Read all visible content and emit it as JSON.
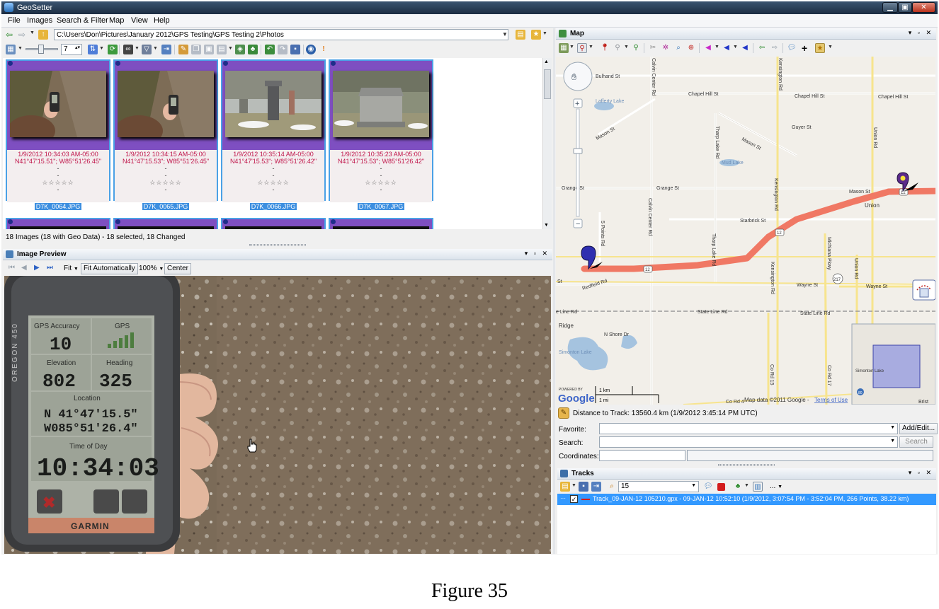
{
  "window": {
    "title": "GeoSetter"
  },
  "menu": [
    "File",
    "Images",
    "Search & Filter",
    "Map",
    "View",
    "Help"
  ],
  "path": {
    "value": "C:\\Users\\Don\\Pictures\\January 2012\\GPS Testing\\GPS Testing 2\\Photos"
  },
  "thumb_toolbar": {
    "size_value": "7"
  },
  "thumbnails": [
    {
      "date": "1/9/2012 10:34:03 AM-05:00",
      "coords": "N41°47'15.51\"; W85°51'26.45\"",
      "dash1": "-",
      "dash2": "-",
      "stars": "☆☆☆☆☆",
      "dash3": "-",
      "filename": "D7K_0064.JPG"
    },
    {
      "date": "1/9/2012 10:34:15 AM-05:00",
      "coords": "N41°47'15.53\"; W85°51'26.45\"",
      "dash1": "-",
      "dash2": "-",
      "stars": "☆☆☆☆☆",
      "dash3": "-",
      "filename": "D7K_0065.JPG"
    },
    {
      "date": "1/9/2012 10:35:14 AM-05:00",
      "coords": "N41°47'15.53\"; W85°51'26.42\"",
      "dash1": "-",
      "dash2": "-",
      "stars": "☆☆☆☆☆",
      "dash3": "-",
      "filename": "D7K_0066.JPG"
    },
    {
      "date": "1/9/2012 10:35:23 AM-05:00",
      "coords": "N41°47'15.53\"; W85°51'26.42\"",
      "dash1": "-",
      "dash2": "-",
      "stars": "☆☆☆☆☆",
      "dash3": "-",
      "filename": "D7K_0067.JPG"
    }
  ],
  "status": {
    "images": "18 Images (18 with Geo Data) - 18 selected, 18 Changed"
  },
  "preview": {
    "title": "Image Preview",
    "fit_label": "Fit",
    "fit_auto_label": "Fit Automatically",
    "zoom": "100%",
    "center_label": "Center"
  },
  "gps_device": {
    "brand": "GARMIN",
    "model": "OREGON 450",
    "accuracy_label": "GPS Accuracy",
    "accuracy_value": "10",
    "gps_label": "GPS",
    "elevation_label": "Elevation",
    "elevation_value": "802",
    "heading_label": "Heading",
    "heading_value": "325",
    "location_label": "Location",
    "lat": "N  41°47'15.5\"",
    "lon": "W085°51'26.4\"",
    "time_label": "Time of Day",
    "time_value": "10:34:03"
  },
  "map": {
    "title": "Map",
    "streets": {
      "bulhand": "Bulhand St",
      "calvin1": "Calvin Center Rd",
      "kensington1": "Kensington Rd",
      "chapel1": "Chapel Hill St",
      "chapel2": "Chapel Hill St",
      "chapel3": "Chapel Hill St",
      "lafferty": "Lafferty Lake",
      "mason1": "Mason St",
      "guyer": "Guyer St",
      "union_rd": "Union Rd",
      "tharp1": "Tharp Lake Rd",
      "mason2": "Mason St",
      "mud": "Mud Lake",
      "grange1": "Grange St",
      "grange2": "Grange St",
      "kensington2": "Kensington Rd",
      "mason3": "Mason St",
      "union": "Union",
      "starbrick": "Starbrick St",
      "points": "5 Points Rd",
      "calvin2": "Calvin Center Rd",
      "tharp2": "Tharp Lake Rd",
      "michiana": "Michiana Pkwy",
      "union_rd2": "Union Rd",
      "st": "St",
      "redfield": "Redfield Rd",
      "wayne1": "Wayne St",
      "wayne2": "Wayne St",
      "kensington3": "Kensington Rd",
      "stateline1": "e Line Rd",
      "stateline2": "State Line Rd",
      "stateline3": "State Line Rd",
      "ridge": "Ridge",
      "northshore": "N Shore Dr",
      "simonton": "Simonton Lake",
      "corsd15": "Co Rd 15",
      "cord17": "Co Rd 17",
      "cord4": "Co Rd 4",
      "r12a": "12",
      "r12b": "12",
      "r12c": "12",
      "r217": "217",
      "mini_simonton": "Simonton Lake",
      "mini_80": "80",
      "bris": "Brist"
    },
    "scale_km": "1 km",
    "scale_mi": "1 mi",
    "powered": "POWERED BY",
    "google": "Google",
    "attribution": "Map data ©2011 Google -",
    "terms": "Terms of Use",
    "route_color": "#f07864"
  },
  "distance": {
    "text": "Distance to Track: 13560.4 km (1/9/2012 3:45:14 PM UTC)"
  },
  "fields": {
    "favorite_label": "Favorite:",
    "add_edit_label": "Add/Edit...",
    "search_label": "Search:",
    "search_button": "Search",
    "coordinates_label": "Coordinates:"
  },
  "tracks": {
    "title": "Tracks",
    "zoom_value": "15",
    "more_label": "...",
    "row_text": "Track_09-JAN-12 105210.gpx - 09-JAN-12 10:52:10 (1/9/2012, 3:07:54 PM - 3:52:04 PM, 266 Points, 38.22 km)"
  },
  "caption": "Figure 35"
}
